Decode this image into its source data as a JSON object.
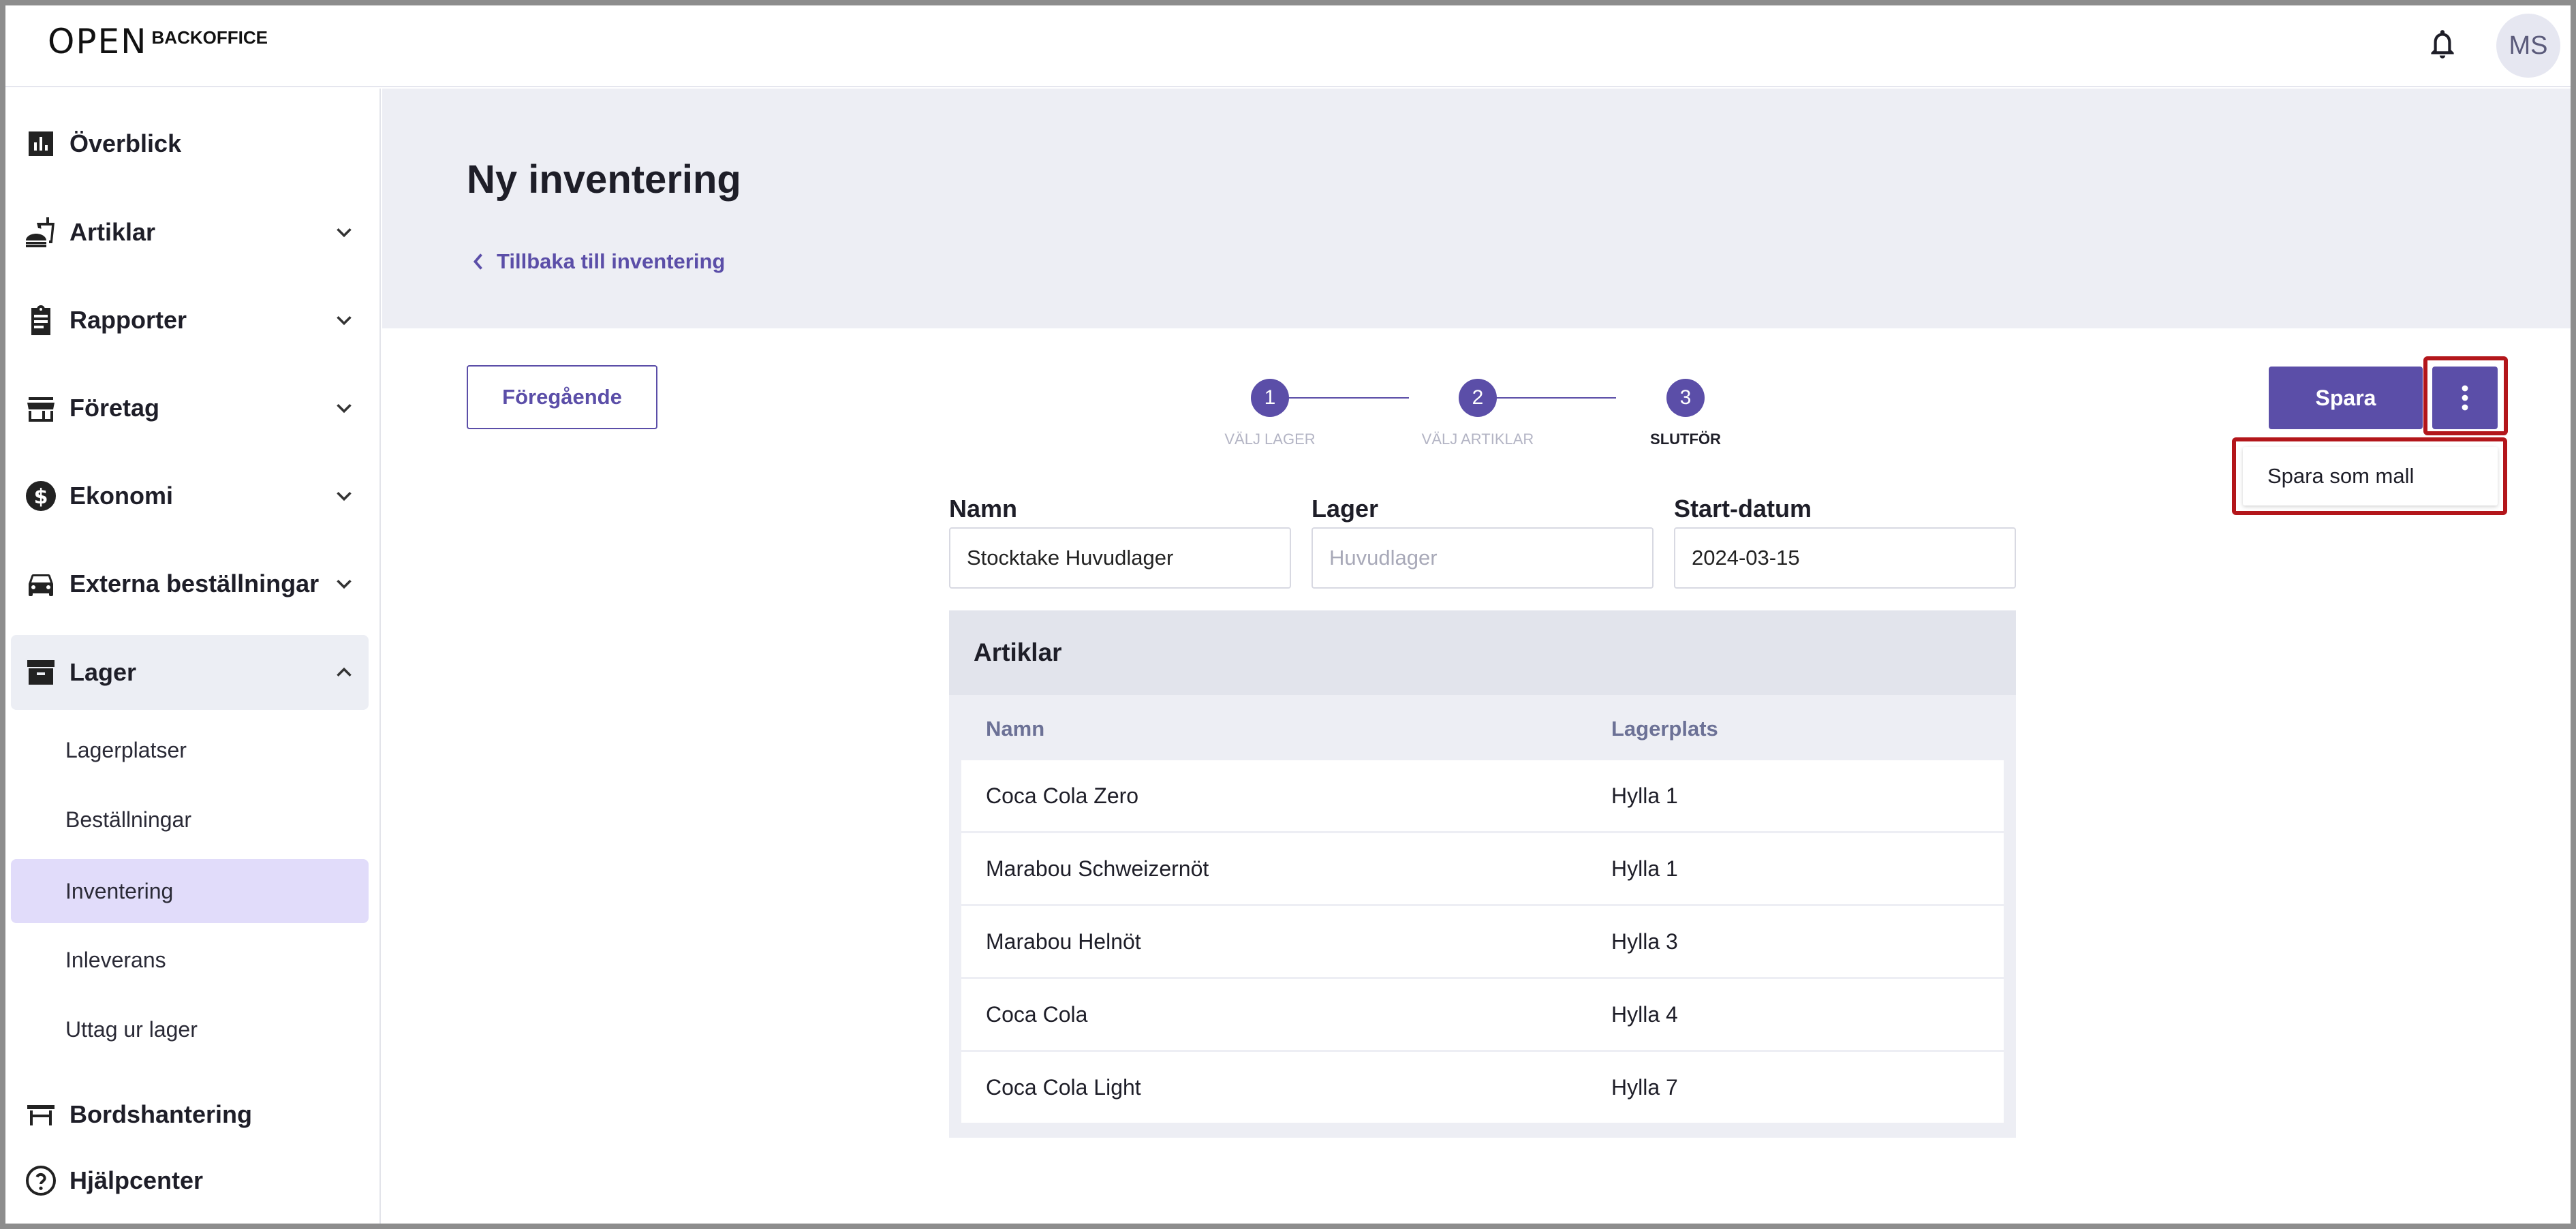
{
  "header": {
    "logo_mark": "OPEN",
    "logo_text": "BACKOFFICE",
    "avatar_initials": "MS"
  },
  "sidebar": {
    "items": [
      {
        "label": "Överblick",
        "icon": "bar-chart-icon",
        "expandable": false
      },
      {
        "label": "Artiklar",
        "icon": "fastfood-icon",
        "expandable": true
      },
      {
        "label": "Rapporter",
        "icon": "clipboard-icon",
        "expandable": true
      },
      {
        "label": "Företag",
        "icon": "storefront-icon",
        "expandable": true
      },
      {
        "label": "Ekonomi",
        "icon": "dollar-circle-icon",
        "expandable": true
      },
      {
        "label": "Externa beställningar",
        "icon": "car-icon",
        "expandable": true
      },
      {
        "label": "Lager",
        "icon": "archive-icon",
        "expandable": true,
        "expanded": true
      }
    ],
    "lager_sub": [
      {
        "label": "Lagerplatser"
      },
      {
        "label": "Beställningar"
      },
      {
        "label": "Inventering",
        "selected": true
      },
      {
        "label": "Inleverans"
      },
      {
        "label": "Uttag ur lager"
      }
    ],
    "bottom": [
      {
        "label": "Bordshantering",
        "icon": "table-icon"
      },
      {
        "label": "Hjälpcenter",
        "icon": "help-circle-icon"
      }
    ]
  },
  "page": {
    "title": "Ny inventering",
    "back_link": "Tillbaka till inventering"
  },
  "actions": {
    "previous": "Föregående",
    "save": "Spara",
    "menu_items": [
      "Spara som mall"
    ]
  },
  "stepper": {
    "steps": [
      {
        "number": "1",
        "label": "Välj lager"
      },
      {
        "number": "2",
        "label": "Välj artiklar"
      },
      {
        "number": "3",
        "label": "Slutför",
        "current": true
      }
    ]
  },
  "form": {
    "name_label": "Namn",
    "name_value": "Stocktake Huvudlager",
    "warehouse_label": "Lager",
    "warehouse_placeholder": "Huvudlager",
    "start_label": "Start-datum",
    "start_value": "2024-03-15"
  },
  "articles": {
    "title": "Artiklar",
    "columns": [
      "Namn",
      "Lagerplats"
    ],
    "rows": [
      {
        "name": "Coca Cola Zero",
        "location": "Hylla 1"
      },
      {
        "name": "Marabou Schweizernöt",
        "location": "Hylla 1"
      },
      {
        "name": "Marabou Helnöt",
        "location": "Hylla 3"
      },
      {
        "name": "Coca Cola",
        "location": "Hylla 4"
      },
      {
        "name": "Coca Cola Light",
        "location": "Hylla 7"
      }
    ]
  },
  "colors": {
    "accent": "#5b4ea8",
    "highlight": "#b3161b",
    "selected_nav": "#e1dcfa"
  }
}
